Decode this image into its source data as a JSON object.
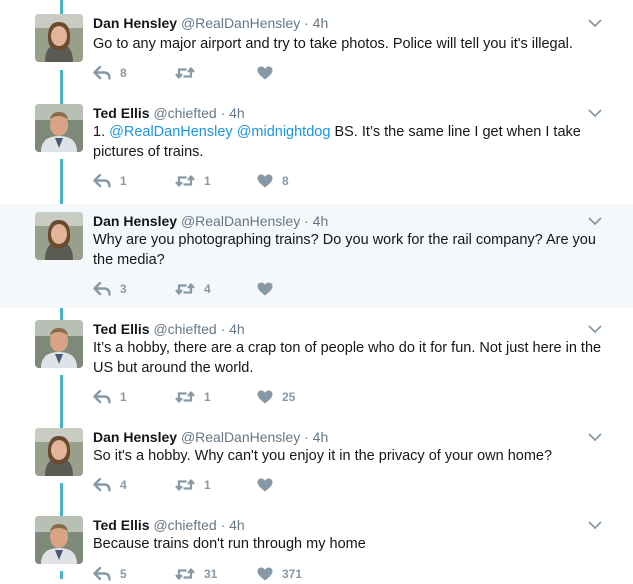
{
  "tweets": [
    {
      "name": "Dan Hensley",
      "handle": "@RealDanHensley",
      "dot": "·",
      "time": "4h",
      "text": "Go to any major airport and try to take photos. Police will tell you it's illegal.",
      "replies": "8",
      "retweets": "",
      "likes": ""
    },
    {
      "name": "Ted Ellis",
      "handle": "@chiefted",
      "dot": "·",
      "time": "4h",
      "prefix": "1. ",
      "mention1": "@RealDanHensley",
      "space": " ",
      "mention2": "@midnightdog",
      "text_rest": " BS. It’s the same line I get when I take pictures of trains.",
      "replies": "1",
      "retweets": "1",
      "likes": "8"
    },
    {
      "name": "Dan Hensley",
      "handle": "@RealDanHensley",
      "dot": "·",
      "time": "4h",
      "text": "Why are you photographing trains? Do you work for the rail company? Are you the media?",
      "replies": "3",
      "retweets": "4",
      "likes": ""
    },
    {
      "name": "Ted Ellis",
      "handle": "@chiefted",
      "dot": "·",
      "time": "4h",
      "text": "It’s a hobby, there are a crap ton of people who do it for fun. Not just here in the US but around the world.",
      "replies": "1",
      "retweets": "1",
      "likes": "25"
    },
    {
      "name": "Dan Hensley",
      "handle": "@RealDanHensley",
      "dot": "·",
      "time": "4h",
      "text": "So it's a hobby. Why can't you enjoy it in the privacy of your own home?",
      "replies": "4",
      "retweets": "1",
      "likes": ""
    },
    {
      "name": "Ted Ellis",
      "handle": "@chiefted",
      "dot": "·",
      "time": "4h",
      "text": "Because trains don't run through my home",
      "replies": "5",
      "retweets": "31",
      "likes": "371"
    }
  ],
  "icons": {
    "reply": "reply-icon",
    "retweet": "retweet-icon",
    "like": "heart-icon",
    "more": "chevron-down-icon"
  },
  "colors": {
    "thread_line": "#4ab3c4",
    "mention": "#1b95e0",
    "highlight_bg": "#f5f8fa",
    "action_gray": "#8899a6"
  }
}
